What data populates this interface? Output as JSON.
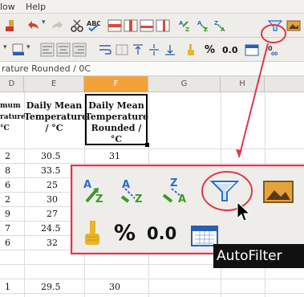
{
  "menu": {
    "items": [
      "low",
      "Help"
    ]
  },
  "toolbar2": {
    "percent": "%",
    "decimal": "0.0"
  },
  "formula_bar": {
    "cell_text": "rature Rounded / 0C"
  },
  "columns": [
    "D",
    "E",
    "F",
    "G",
    "H"
  ],
  "headers": {
    "d": [
      "mum",
      "rature",
      "°C"
    ],
    "e": [
      "Daily Mean",
      "Temperature",
      "/ °C"
    ],
    "f": [
      "Daily Mean",
      "Temperature",
      "Rounded / °C"
    ]
  },
  "rows": [
    {
      "d": "2",
      "e": "30.5",
      "f": "31"
    },
    {
      "d": "8",
      "e": "33.5",
      "f": ""
    },
    {
      "d": "6",
      "e": "25",
      "f": ""
    },
    {
      "d": "2",
      "e": "30",
      "f": ""
    },
    {
      "d": "9",
      "e": "27",
      "f": ""
    },
    {
      "d": "7",
      "e": "24.5",
      "f": ""
    },
    {
      "d": "6",
      "e": "32",
      "f": ""
    },
    {
      "d": "1",
      "e": "29.5",
      "f": "30"
    }
  ],
  "popup": {
    "percent": "%",
    "decimal": "0.0"
  },
  "tooltip": {
    "label": "AutoFilter"
  },
  "colors": {
    "highlight": "#e0374b",
    "selected_column": "#f5a13a"
  }
}
